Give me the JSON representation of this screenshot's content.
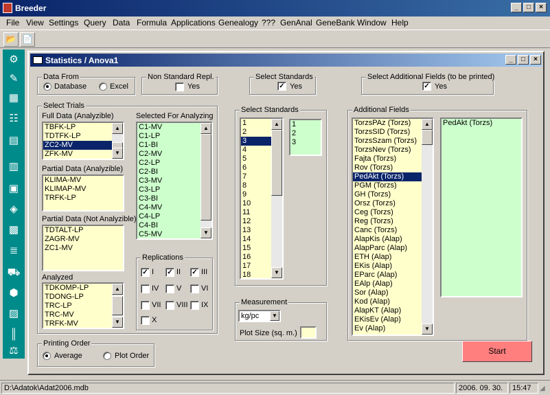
{
  "app": {
    "title": "Breeder"
  },
  "menu": [
    "File",
    "View",
    "Settings",
    "Query",
    "Data",
    "Formula",
    "Applications",
    "Genealogy",
    "???",
    "GenAnal",
    "GeneBank",
    "Window",
    "Help"
  ],
  "window": {
    "title": "Statistics / Anova1"
  },
  "data_from": {
    "label": "Data From",
    "opt1": "Database",
    "opt2": "Excel",
    "selected": "Database"
  },
  "non_std": {
    "label": "Non Standard Repl.",
    "yes": "Yes",
    "checked": false
  },
  "sel_std_top": {
    "label": "Select Standards",
    "yes": "Yes",
    "checked": true
  },
  "sel_add": {
    "label": "Select Additional Fields (to be printed)",
    "yes": "Yes",
    "checked": true
  },
  "trials": {
    "label": "Select Trials",
    "full_label": "Full Data (Analyzible)",
    "full": [
      "TBFK-LP",
      "TDTFK-LP",
      "ZC2-MV",
      "ZFK-MV"
    ],
    "full_selected": "ZC2-MV",
    "partial_label": "Partial Data (Analyzible)",
    "partial": [
      "KLIMA-MV",
      "KLIMAP-MV",
      "TRFK-LP"
    ],
    "partial_na_label": "Partial Data (Not Analyzible)",
    "partial_na": [
      "TDTALT-LP",
      "ZAGR-MV",
      "ZC1-MV"
    ],
    "analyzed_label": "Analyzed",
    "analyzed": [
      "TDKOMP-LP",
      "TDONG-LP",
      "TRC-LP",
      "TRC-MV",
      "TRFK-MV"
    ],
    "selected_label": "Selected For Analyzing",
    "selected": [
      "C1-MV",
      "C1-LP",
      "C1-BI",
      "C2-MV",
      "C2-LP",
      "C2-BI",
      "C3-MV",
      "C3-LP",
      "C3-BI",
      "C4-MV",
      "C4-LP",
      "C4-BI",
      "C5-MV"
    ]
  },
  "replications": {
    "label": "Replications",
    "items": [
      {
        "n": "I",
        "c": true
      },
      {
        "n": "II",
        "c": true
      },
      {
        "n": "III",
        "c": true
      },
      {
        "n": "IV",
        "c": false
      },
      {
        "n": "V",
        "c": false
      },
      {
        "n": "VI",
        "c": false
      },
      {
        "n": "VII",
        "c": false
      },
      {
        "n": "VIII",
        "c": false
      },
      {
        "n": "IX",
        "c": false
      },
      {
        "n": "X",
        "c": false
      }
    ]
  },
  "standards": {
    "label": "Select Standards",
    "items": [
      "1",
      "2",
      "3",
      "4",
      "5",
      "6",
      "7",
      "8",
      "9",
      "10",
      "11",
      "12",
      "13",
      "14",
      "15",
      "16",
      "17",
      "18"
    ],
    "selected_item": "3",
    "chosen": [
      "1",
      "2",
      "3"
    ]
  },
  "measurement": {
    "label": "Measurement",
    "unit": "kg/pc",
    "plot_label": "Plot Size (sq. m.)",
    "plot_value": ""
  },
  "additional": {
    "label": "Additional Fields",
    "items": [
      "TorzsPAz (Torzs)",
      "TorzsSID (Torzs)",
      "TorzsSzam (Torzs)",
      "TorzsNev (Torzs)",
      "Fajta (Torzs)",
      "Rov (Torzs)",
      "PedAkt (Torzs)",
      "PGM (Torzs)",
      "GH (Torzs)",
      "Orsz (Torzs)",
      "Ceg (Torzs)",
      "Reg (Torzs)",
      "Canc (Torzs)",
      "AlapKis (Alap)",
      "AlapParc (Alap)",
      "ETH (Alap)",
      "EKis (Alap)",
      "EParc (Alap)",
      "EAlp (Alap)",
      "Sor (Alap)",
      "Kod (Alap)",
      "AlapKT (Alap)",
      "EKisEv (Alap)",
      "Ev (Alap)"
    ],
    "selected_item": "PedAkt (Torzs)",
    "chosen": [
      "PedAkt (Torzs)"
    ]
  },
  "printing": {
    "label": "Printing Order",
    "opt1": "Average",
    "opt2": "Plot Order",
    "selected": "Average"
  },
  "start": "Start",
  "status": {
    "path": "D:\\Adatok\\Adat2006.mdb",
    "date": "2006. 09. 30.",
    "time": "15:47"
  }
}
